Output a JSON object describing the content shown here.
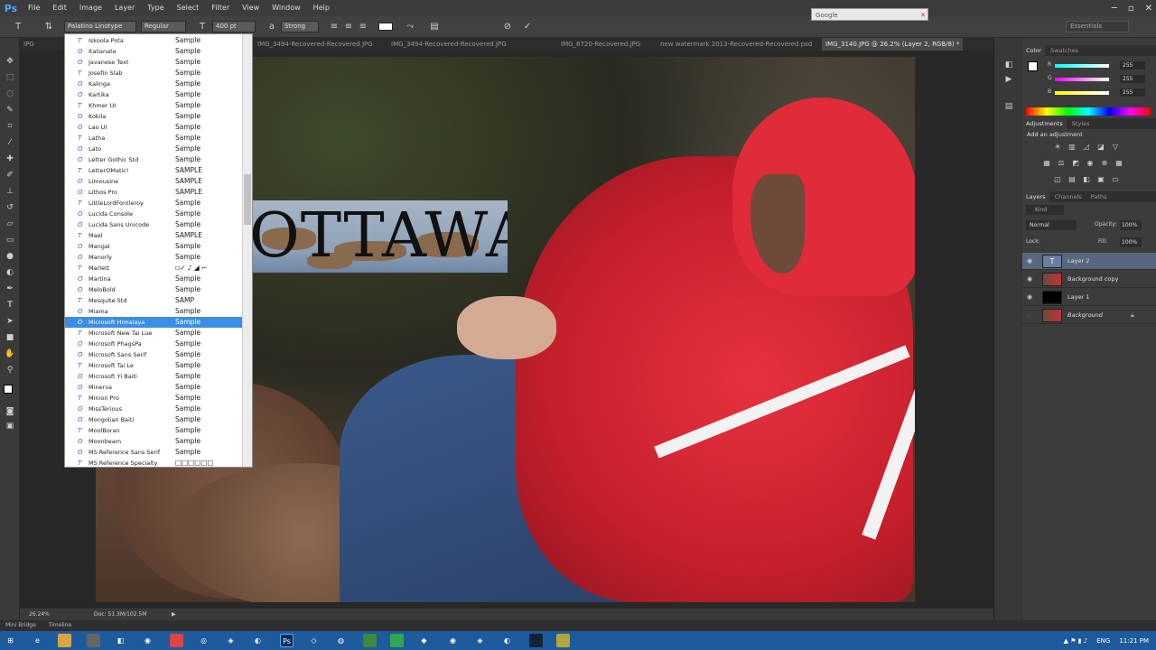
{
  "app": {
    "logo": "Ps"
  },
  "menu": [
    "File",
    "Edit",
    "Image",
    "Layer",
    "Type",
    "Select",
    "Filter",
    "View",
    "Window",
    "Help"
  ],
  "google_box": {
    "text": "Google"
  },
  "options": {
    "font_family": "Palatino Linotype",
    "font_style": "Regular",
    "font_size": "400 pt",
    "antialias": "Strong",
    "workspace": "Essentials"
  },
  "tabs": [
    "IPG",
    "IMG_3494-Recovered-Recovered.JPG",
    "IMG_3494-Recovered-Recovered.JPG",
    "IMG_6720-Recovered.JPG",
    "new watermark 2013-Recovered-Recovered.psd",
    "IMG_3140.JPG @ 26.2% (Layer 2, RGB/8) *"
  ],
  "font_list": [
    {
      "name": "Iskoola Pota",
      "sample": "Sample"
    },
    {
      "name": "Italianate",
      "sample": "Sample"
    },
    {
      "name": "Javanese Text",
      "sample": "Sample"
    },
    {
      "name": "Josefin Slab",
      "sample": "Sample"
    },
    {
      "name": "Kalinga",
      "sample": "Sample"
    },
    {
      "name": "Kartika",
      "sample": "Sample"
    },
    {
      "name": "Khmer UI",
      "sample": "Sample"
    },
    {
      "name": "Kokila",
      "sample": "Sample"
    },
    {
      "name": "Lao UI",
      "sample": "Sample"
    },
    {
      "name": "Latha",
      "sample": "Sample"
    },
    {
      "name": "Lato",
      "sample": "Sample"
    },
    {
      "name": "Letter Gothic Std",
      "sample": "Sample"
    },
    {
      "name": "LetterOMatic!",
      "sample": "SAMPLE"
    },
    {
      "name": "Limousine",
      "sample": "SAMPLE"
    },
    {
      "name": "Lithos Pro",
      "sample": "SAMPLE"
    },
    {
      "name": "LittleLordFontleroy",
      "sample": "Sample"
    },
    {
      "name": "Lucida Console",
      "sample": "Sample"
    },
    {
      "name": "Lucida Sans Unicode",
      "sample": "Sample"
    },
    {
      "name": "Mael",
      "sample": "SAMPLE"
    },
    {
      "name": "Mangal",
      "sample": "Sample"
    },
    {
      "name": "Manorly",
      "sample": "Sample"
    },
    {
      "name": "Marlett",
      "sample": "▫✓ ♪ ◢ ⌐"
    },
    {
      "name": "Martina",
      "sample": "Sample"
    },
    {
      "name": "MeloBold",
      "sample": "Sample"
    },
    {
      "name": "Mesquite Std",
      "sample": "SAMP"
    },
    {
      "name": "Miama",
      "sample": "Sample"
    },
    {
      "name": "Microsoft Himalaya",
      "sample": "Sample"
    },
    {
      "name": "Microsoft New Tai Lue",
      "sample": "Sample"
    },
    {
      "name": "Microsoft PhagsPa",
      "sample": "Sample"
    },
    {
      "name": "Microsoft Sans Serif",
      "sample": "Sample"
    },
    {
      "name": "Microsoft Tai Le",
      "sample": "Sample"
    },
    {
      "name": "Microsoft Yi Baiti",
      "sample": "Sample"
    },
    {
      "name": "Minerva",
      "sample": "Sample"
    },
    {
      "name": "Minion Pro",
      "sample": "Sample"
    },
    {
      "name": "MissTerious",
      "sample": "Sample"
    },
    {
      "name": "Mongolian Baiti",
      "sample": "Sample"
    },
    {
      "name": "MoolBoran",
      "sample": "Sample"
    },
    {
      "name": "Moonbeam",
      "sample": "Sample"
    },
    {
      "name": "MS Reference Sans Serif",
      "sample": "Sample"
    },
    {
      "name": "MS Reference Specialty",
      "sample": "□□□□□□"
    }
  ],
  "selected_font": "Microsoft Himalaya",
  "canvas_text": "OTTAWA",
  "panels": {
    "color_tabs": [
      "Color",
      "Swatches"
    ],
    "rgb": [
      {
        "label": "R",
        "value": "255"
      },
      {
        "label": "G",
        "value": "255"
      },
      {
        "label": "B",
        "value": "255"
      }
    ],
    "adjust_tabs": [
      "Adjustments",
      "Styles"
    ],
    "adjust_title": "Add an adjustment",
    "layer_tabs": [
      "Layers",
      "Channels",
      "Paths"
    ],
    "kind": "Kind",
    "blend_mode": "Normal",
    "opacity_label": "Opacity:",
    "opacity": "100%",
    "lock_label": "Lock:",
    "fill_label": "Fill:",
    "fill": "100%",
    "layers": [
      {
        "name": "Layer 2",
        "type": "text"
      },
      {
        "name": "Background copy",
        "type": "photo"
      },
      {
        "name": "Layer 1",
        "type": "black"
      },
      {
        "name": "Background",
        "type": "photo"
      }
    ]
  },
  "status": {
    "zoom": "26.24%",
    "doc": "Doc: 51.3M/102.5M"
  },
  "bottom_tabs": [
    "Mini Bridge",
    "Timeline"
  ],
  "taskbar": {
    "lang": "ENG",
    "time": "11:21 PM"
  },
  "colors": {
    "selection": "#3a8ee6",
    "taskbar": "#1e5b9c",
    "accent": "#e02b39"
  }
}
